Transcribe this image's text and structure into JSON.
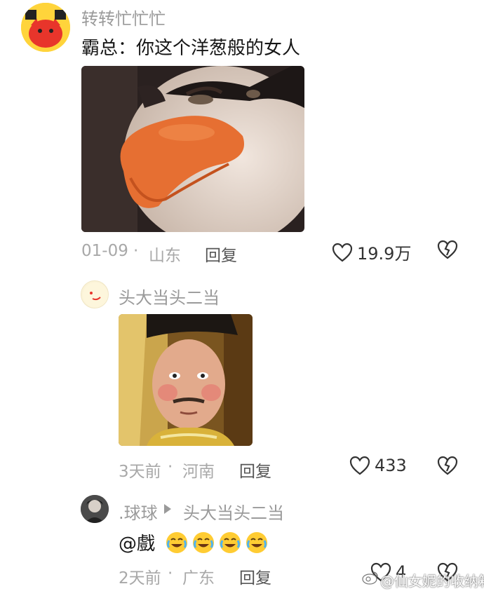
{
  "comments": [
    {
      "user": "转转忙忙忙",
      "text": "霸总：你这个洋葱般的女人",
      "date": "01-09",
      "location": "山东",
      "reply_label": "回复",
      "likes": "19.9万",
      "separator": "·"
    },
    {
      "user": "头大当头二当",
      "date": "3天前",
      "location": "河南",
      "reply_label": "回复",
      "likes": "433",
      "separator": "·"
    },
    {
      "user": ".球球",
      "reply_to": "头大当头二当",
      "text_prefix": "@戲",
      "emojis": [
        "crying-laughing-emoji",
        "crying-laughing-emoji",
        "crying-laughing-emoji",
        "crying-laughing-emoji"
      ],
      "date": "2天前",
      "location": "广东",
      "reply_label": "回复",
      "likes": "4",
      "separator": "·"
    }
  ],
  "watermark": "@仙女妮的收纳箱",
  "colors": {
    "meta_gray": "#a8a8a8",
    "username_gray": "#9a9a9a",
    "text": "#161616"
  }
}
